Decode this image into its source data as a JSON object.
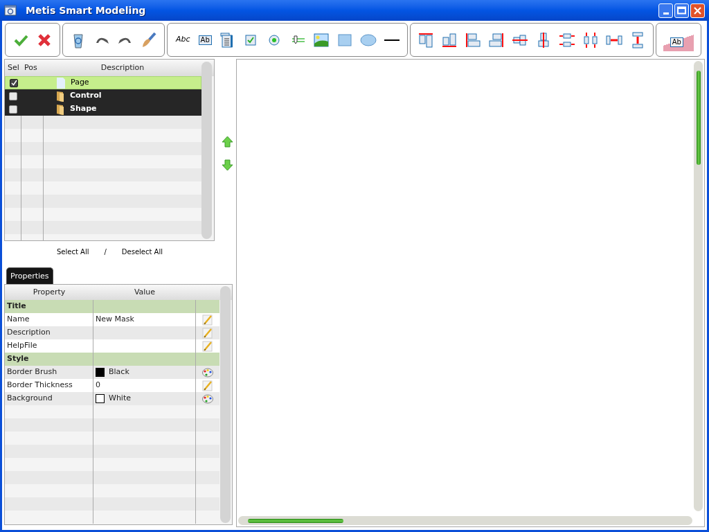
{
  "window": {
    "title": "Metis Smart Modeling"
  },
  "toolbar": [
    {
      "tools": [
        {
          "kind": "accept"
        },
        {
          "kind": "cancel"
        }
      ]
    },
    {
      "tools": [
        {
          "kind": "recycle"
        },
        {
          "kind": "undo"
        },
        {
          "kind": "redo"
        },
        {
          "kind": "brush"
        }
      ]
    },
    {
      "tools": [
        {
          "kind": "label",
          "label": "Abc"
        },
        {
          "kind": "textbox",
          "label": "Ab"
        },
        {
          "kind": "listbox"
        },
        {
          "kind": "checkbox"
        },
        {
          "kind": "radio"
        },
        {
          "kind": "slider"
        },
        {
          "kind": "image"
        },
        {
          "kind": "rectangle"
        },
        {
          "kind": "ellipse"
        },
        {
          "kind": "line"
        }
      ]
    },
    {
      "tools": [
        {
          "kind": "align-top"
        },
        {
          "kind": "align-bottom"
        },
        {
          "kind": "align-left"
        },
        {
          "kind": "align-right"
        },
        {
          "kind": "center-h"
        },
        {
          "kind": "center-v"
        },
        {
          "kind": "same-width"
        },
        {
          "kind": "same-height"
        },
        {
          "kind": "space-h"
        },
        {
          "kind": "space-v"
        }
      ]
    },
    {
      "tools": [
        {
          "kind": "translate",
          "label": "Ab"
        }
      ]
    }
  ],
  "tree": {
    "columns": [
      "Sel",
      "Pos",
      "Description"
    ],
    "rows": [
      {
        "checked": true,
        "selected": true,
        "kind": "page",
        "description": "Page"
      },
      {
        "checked": false,
        "selected": false,
        "kind": "folder",
        "description": "Control"
      },
      {
        "checked": false,
        "selected": false,
        "kind": "folder",
        "description": "Shape"
      }
    ],
    "select_all": "Select All",
    "separator": "/",
    "deselect_all": "Deselect All"
  },
  "properties": {
    "tab": "Properties",
    "columns": [
      "Property",
      "Value"
    ],
    "rows": [
      {
        "kind": "group",
        "name": "Title"
      },
      {
        "kind": "property",
        "name": "Name",
        "value": "New Mask",
        "editor": {
          "kind": "pencil"
        }
      },
      {
        "kind": "property",
        "name": "Description",
        "editor": {
          "kind": "pencil"
        }
      },
      {
        "kind": "property",
        "name": "HelpFile",
        "editor": {
          "kind": "pencil"
        }
      },
      {
        "kind": "group",
        "name": "Style"
      },
      {
        "kind": "property",
        "name": "Border Brush",
        "value": "Black",
        "color": "#000000",
        "editor": {
          "kind": "palette"
        }
      },
      {
        "kind": "property",
        "name": "Border Thickness",
        "value": "0",
        "editor": {
          "kind": "pencil"
        }
      },
      {
        "kind": "property",
        "name": "Background",
        "value": "White",
        "color": "#ffffff",
        "editor": {
          "kind": "palette"
        }
      }
    ]
  }
}
